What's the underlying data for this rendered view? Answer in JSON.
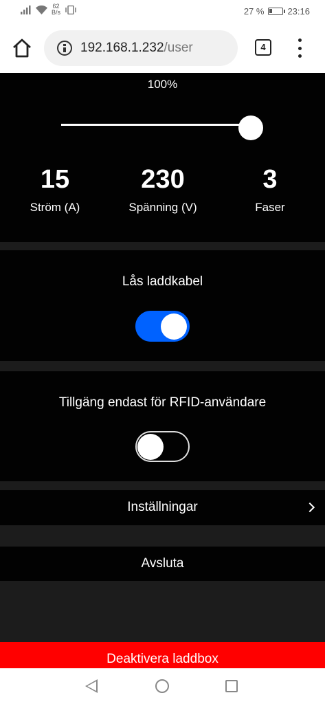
{
  "status_bar": {
    "net_speed_value": "62",
    "net_speed_unit": "B/s",
    "battery_percent": "27 %",
    "battery_level": 0.27,
    "time": "23:16"
  },
  "browser": {
    "url_host": "192.168.1.232",
    "url_path": "/user",
    "tab_count": "4"
  },
  "charge_level": {
    "percent_label": "100%",
    "value": 100
  },
  "stats": [
    {
      "value": "15",
      "label": "Ström (A)"
    },
    {
      "value": "230",
      "label": "Spänning (V)"
    },
    {
      "value": "3",
      "label": "Faser"
    }
  ],
  "lock_cable": {
    "label": "Lås laddkabel",
    "enabled": true
  },
  "rfid_only": {
    "label": "Tillgäng endast för RFID-användare",
    "enabled": false
  },
  "menu": {
    "settings_label": "Inställningar",
    "exit_label": "Avsluta"
  },
  "deactivate_label": "Deaktivera laddbox",
  "colors": {
    "accent_blue": "#0062ff",
    "danger_red": "#ff0000",
    "panel_bg": "#020202",
    "page_bg": "#1c1c1c"
  }
}
